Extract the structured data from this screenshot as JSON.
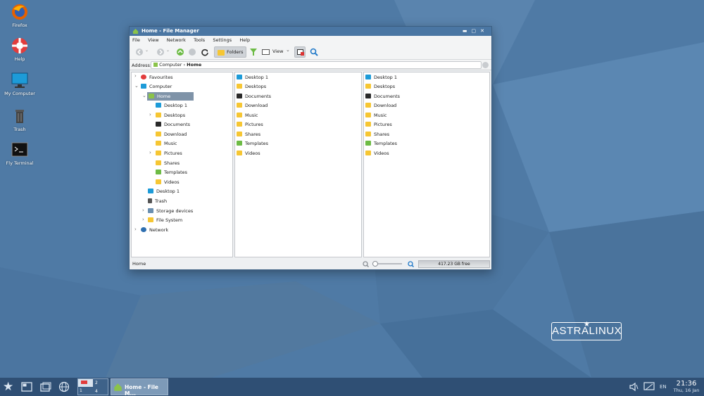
{
  "desktop": {
    "icons": [
      {
        "label": "Firefox",
        "icon": "firefox-icon"
      },
      {
        "label": "Help",
        "icon": "help-icon"
      },
      {
        "label": "My Computer",
        "icon": "computer-icon"
      },
      {
        "label": "Trash",
        "icon": "trash-icon"
      },
      {
        "label": "Fly Terminal",
        "icon": "terminal-icon"
      }
    ],
    "logo_text": "ASTRALINUX"
  },
  "window": {
    "title": "Home - File Manager",
    "menu": [
      "File",
      "View",
      "Network",
      "Tools",
      "Settings",
      "Help"
    ],
    "toolbar": {
      "folders_label": "Folders",
      "view_label": "View"
    },
    "address": {
      "label": "Address:",
      "crumb_1": "Computer",
      "separator": "›",
      "crumb_2": "Home"
    },
    "tree": [
      {
        "label": "Favourites",
        "icon": "heart-icon"
      },
      {
        "label": "Computer",
        "icon": "monitor-icon"
      },
      {
        "label": "Home",
        "icon": "home-icon"
      },
      {
        "label": "Desktop 1",
        "icon": "desktop-icon"
      },
      {
        "label": "Desktops",
        "icon": "folder-icon"
      },
      {
        "label": "Documents",
        "icon": "documents-icon"
      },
      {
        "label": "Download",
        "icon": "download-icon"
      },
      {
        "label": "Music",
        "icon": "music-icon"
      },
      {
        "label": "Pictures",
        "icon": "pictures-icon"
      },
      {
        "label": "Shares",
        "icon": "shares-icon"
      },
      {
        "label": "Templates",
        "icon": "templates-icon"
      },
      {
        "label": "Videos",
        "icon": "videos-icon"
      },
      {
        "label": "Desktop 1",
        "icon": "desktop-icon"
      },
      {
        "label": "Trash",
        "icon": "trash-icon"
      },
      {
        "label": "Storage devices",
        "icon": "storage-icon"
      },
      {
        "label": "File System",
        "icon": "folder-icon"
      },
      {
        "label": "Network",
        "icon": "network-icon"
      }
    ],
    "middle_list": [
      "Desktop 1",
      "Desktops",
      "Documents",
      "Download",
      "Music",
      "Pictures",
      "Shares",
      "Templates",
      "Videos"
    ],
    "right_list": [
      "Desktop 1",
      "Desktops",
      "Documents",
      "Download",
      "Music",
      "Pictures",
      "Shares",
      "Templates",
      "Videos"
    ],
    "status": {
      "location": "Home",
      "free_space": "417.23 GB free"
    }
  },
  "taskbar": {
    "workspaces": [
      "1",
      "2",
      "3",
      "4"
    ],
    "task_label": "Home - File M...",
    "language": "EN",
    "time": "21:36",
    "date": "Thu, 16 Jan"
  },
  "colors": {
    "wallpaper": "#4f7aa5",
    "titlebar": "#4a76a3",
    "taskbar": "#2f4f74",
    "selection": "#7f93a8"
  }
}
